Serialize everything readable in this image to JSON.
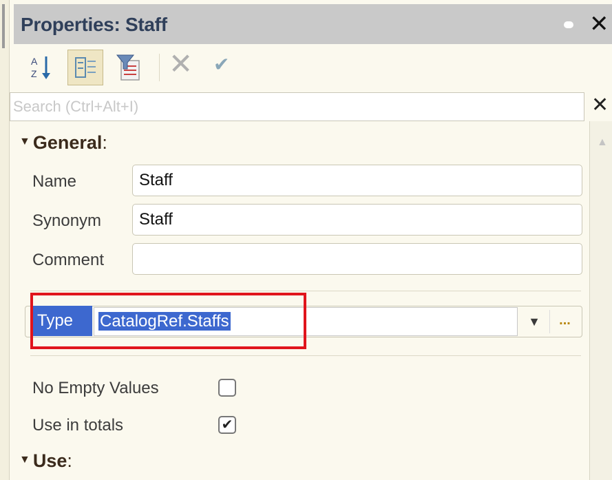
{
  "window": {
    "title": "Properties: Staff"
  },
  "toolbar": {
    "sort_icon": "sort-alphabetical-icon",
    "categories_icon": "categorized-view-icon",
    "filter_icon": "filter-icon",
    "cancel_icon": "cancel-icon",
    "apply_icon": "apply-icon"
  },
  "search": {
    "placeholder": "Search (Ctrl+Alt+I)"
  },
  "sections": {
    "general": "General",
    "general_colon": ":",
    "use": "Use",
    "use_colon": ":"
  },
  "fields": {
    "name_label": "Name",
    "name_value": "Staff",
    "synonym_label": "Synonym",
    "synonym_value": "Staff",
    "comment_label": "Comment",
    "comment_value": "",
    "type_label": "Type",
    "type_value": "CatalogRef.Staffs",
    "type_more": "...",
    "no_empty_label": "No Empty Values",
    "no_empty_checked": false,
    "totals_label": "Use in totals",
    "totals_checked": true
  },
  "colors": {
    "selection": "#3d68cf",
    "highlight": "#e0141c",
    "titlebar": "#c9c9c9"
  }
}
